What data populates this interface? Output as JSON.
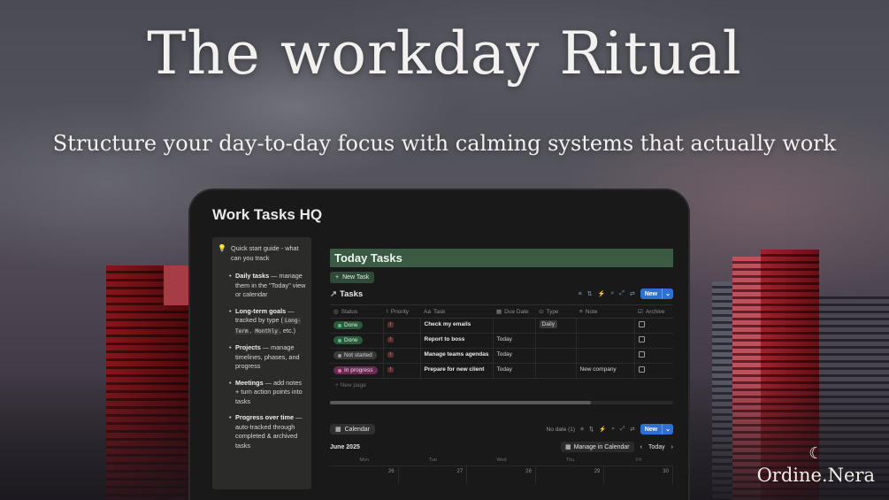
{
  "headline": "The workday Ritual",
  "subheadline": "Structure your day-to-day focus with calming systems that actually work",
  "brand": {
    "name": "Ordine.Nera",
    "icon": "crescent-moon-icon"
  },
  "app": {
    "page_title": "Work Tasks HQ",
    "guide": {
      "heading": "Quick start guide - what can you track",
      "items": [
        {
          "title": "Daily tasks",
          "text": " — manage them in the \"Today\" view or calendar"
        },
        {
          "title": "Long-term goals",
          "text_before": " — tracked by type (",
          "code1": "Long-Term",
          "sep": ", ",
          "code2": "Monthly",
          "text_after": ", etc.)"
        },
        {
          "title": "Projects",
          "text": " — manage timelines, phases, and progress"
        },
        {
          "title": "Meetings",
          "text": " — add notes + turn action points into tasks"
        },
        {
          "title": "Progress over time",
          "text": " — auto-tracked through completed & archived tasks"
        }
      ]
    },
    "today_banner": "Today Tasks",
    "new_task_label": "New Task",
    "db_title": "Tasks",
    "new_button": "New",
    "columns": [
      "Status",
      "Priority",
      "Task",
      "Due Date",
      "Type",
      "Note",
      "Archive"
    ],
    "rows": [
      {
        "status": "Done",
        "status_kind": "done",
        "priority": "!",
        "task": "Check my emails",
        "due": "",
        "type": "Daily",
        "note": ""
      },
      {
        "status": "Done",
        "status_kind": "done",
        "priority": "!",
        "task": "Report to boss",
        "due": "Today",
        "type": "",
        "note": ""
      },
      {
        "status": "Not started",
        "status_kind": "ns",
        "priority": "!",
        "task": "Manage teams agendas",
        "due": "Today",
        "type": "",
        "note": ""
      },
      {
        "status": "In progress",
        "status_kind": "ip",
        "priority": "!",
        "task": "Prepare for new client",
        "due": "Today",
        "type": "",
        "note": "New company"
      }
    ],
    "new_page_label": "New page",
    "calendar": {
      "tab_label": "Calendar",
      "no_date": "No date (1)",
      "new_button": "New",
      "month": "June 2025",
      "manage_label": "Manage in Calendar",
      "today_label": "Today",
      "weekdays": [
        "Mon",
        "Tue",
        "Wed",
        "Thu",
        "Fri"
      ],
      "days": [
        "26",
        "27",
        "28",
        "29",
        "30"
      ]
    }
  },
  "colors": {
    "banner": "#3a5a44",
    "accent_blue": "#2f6fd0",
    "done": "#2b5a3c",
    "in_progress": "#6a2a52"
  }
}
